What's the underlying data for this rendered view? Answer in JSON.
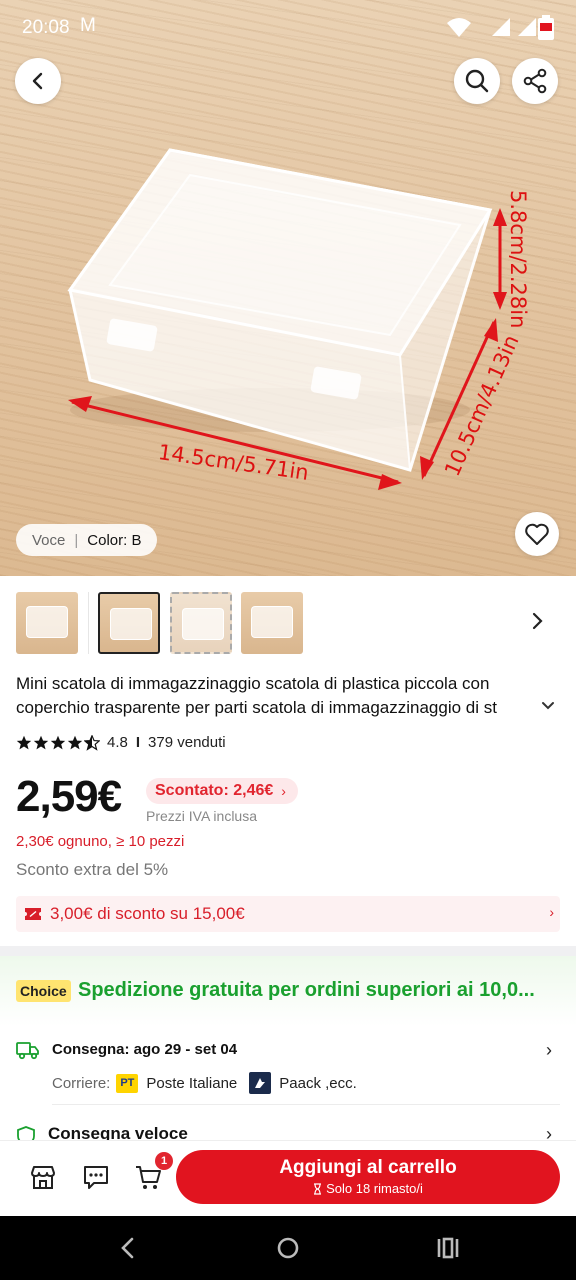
{
  "status_bar": {
    "time": "20:08",
    "notification": "M",
    "network": "4G"
  },
  "product_image": {
    "dimensions": [
      "14.5cm/5.71in",
      "10.5cm/4.13in",
      "5.8cm/2.28in"
    ],
    "variant_label": "Voce",
    "variant_value": "Color: B"
  },
  "thumbnails": {
    "count": 4,
    "selected_index": 1
  },
  "product": {
    "title": "Mini scatola di immagazzinaggio scatola di plastica piccola con coperchio trasparente per parti scatola di immagazzinaggio di st",
    "rating": "4.8",
    "stars": 4.5,
    "sold": "379 venduti"
  },
  "pricing": {
    "price": "2,59€",
    "discounted": "Scontato: 2,46€",
    "vat_note": "Prezzi IVA inclusa",
    "bulk": "2,30€ ognuno, ≥ 10 pezzi",
    "extra_discount": "Sconto extra del 5%",
    "coupon": "3,00€ di sconto su 15,00€"
  },
  "shipping": {
    "badge": "Choice",
    "free_shipping": "Spedizione gratuita per ordini superiori ai 10,0...",
    "delivery_label": "Consegna: ago 29 - set 04",
    "carrier_label": "Corriere:",
    "carrier_1": "Poste Italiane",
    "carrier_1_logo": "PT",
    "carrier_2": "Paack ,ecc.",
    "fast_delivery": "Consegna veloce"
  },
  "action_bar": {
    "cart_count": "1",
    "add_to_cart": "Aggiungi al carrello",
    "stock_note": "Solo 18 rimasto/i"
  },
  "colors": {
    "accent_red": "#e1141f",
    "price_red": "#d81e2a",
    "choice_green": "#1aa02f",
    "choice_badge": "#ffe470"
  },
  "icons": [
    "back-arrow",
    "search",
    "share",
    "heart",
    "chevron-right",
    "store",
    "chat",
    "cart",
    "truck",
    "hourglass",
    "coupon",
    "shield"
  ]
}
